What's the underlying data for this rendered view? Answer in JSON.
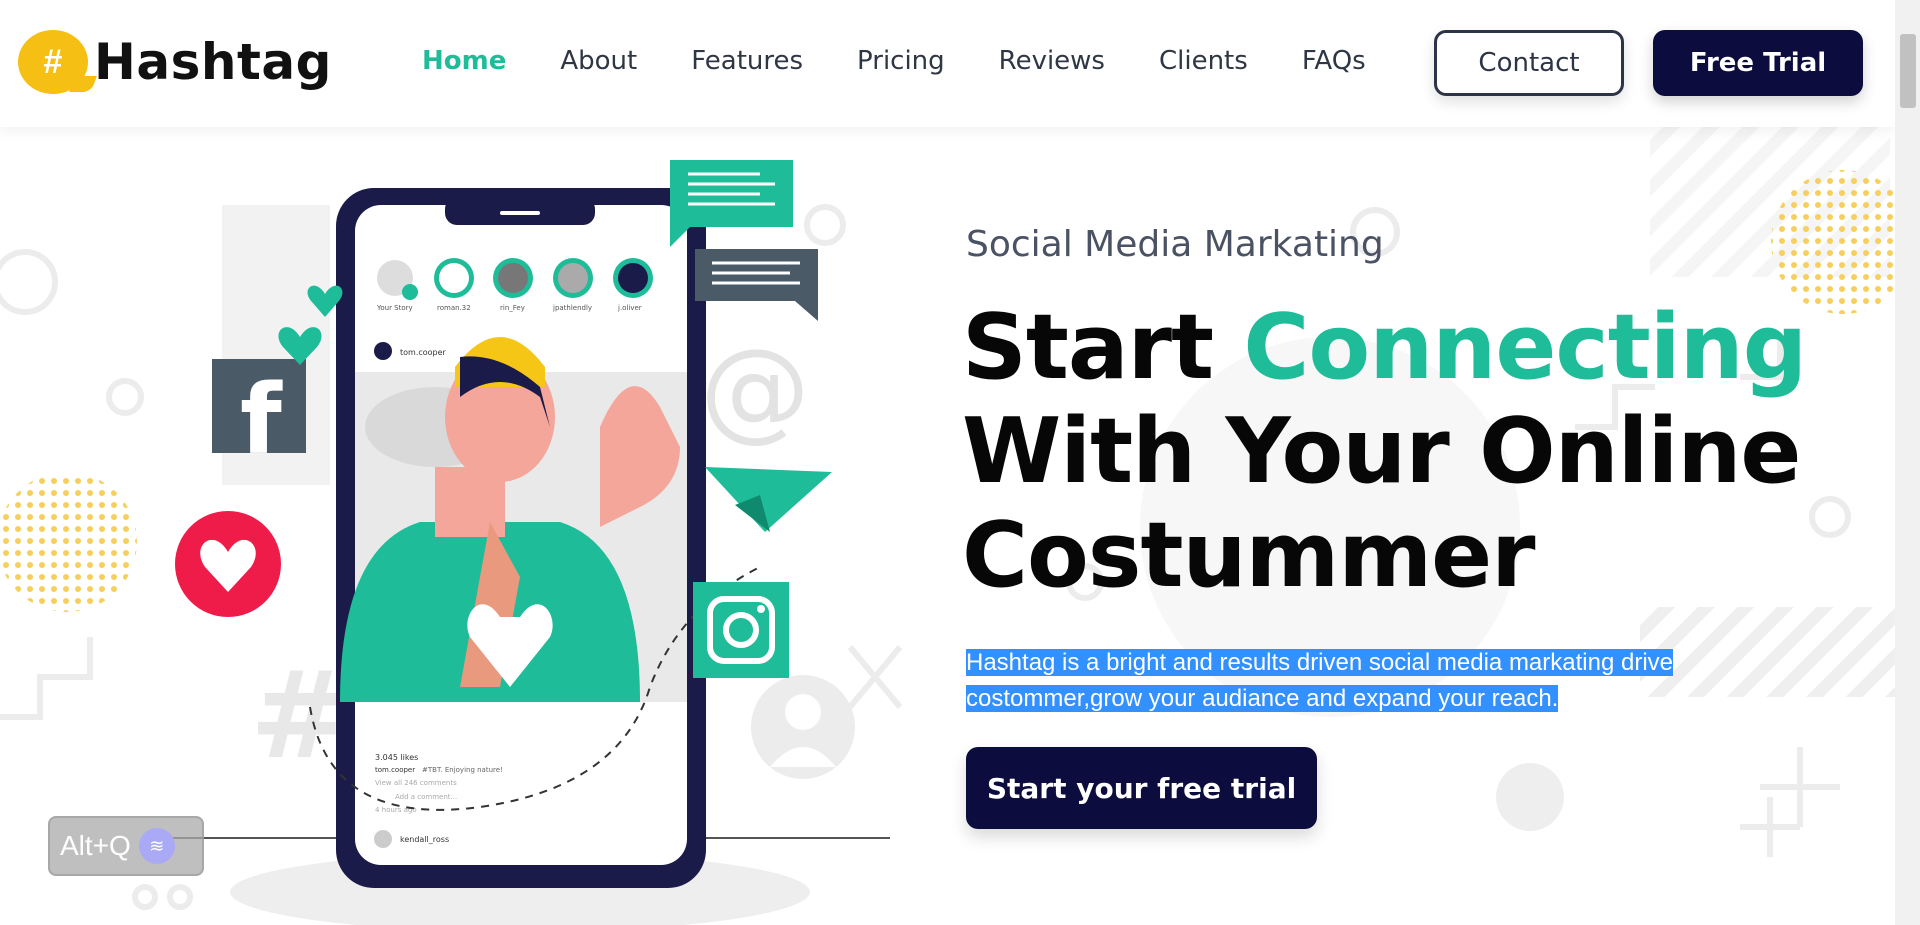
{
  "brand": {
    "name": "Hashtag",
    "logo_glyph": "#",
    "accent": "#1ebc98",
    "dark": "#0c0c3e",
    "yellow": "#f6bf13"
  },
  "nav": {
    "items": [
      {
        "label": "Home",
        "active": true
      },
      {
        "label": "About"
      },
      {
        "label": "Features"
      },
      {
        "label": "Pricing"
      },
      {
        "label": "Reviews"
      },
      {
        "label": "Clients"
      },
      {
        "label": "FAQs"
      }
    ],
    "contact_label": "Contact",
    "trial_label": "Free Trial"
  },
  "hero": {
    "subtitle": "Social Media Markating",
    "headline_pre": "Start",
    "headline_accent": "Connecting",
    "headline_line2": "With Your Online",
    "headline_line3": "Costummer",
    "description": "Hashtag is a bright and results driven social media markating drive costommer,grow your audiance and expand your reach.",
    "cta_label": "Start your free trial"
  },
  "phone": {
    "stories": [
      "Your Story",
      "roman.32",
      "rin_Fey",
      "jpathlendly",
      "j.oliver"
    ],
    "post_user": "tom.cooper",
    "likes": "3.045 likes",
    "caption_user": "tom.cooper",
    "caption_text": "#TBT. Enjoying nature!",
    "view_comments": "View all 246 comments",
    "add_comment": "Add a comment...",
    "time": "4 hours ago",
    "next_user": "kendall_ross"
  },
  "widget": {
    "label": "Alt+Q"
  },
  "icons": [
    "facebook-icon",
    "heart-icon",
    "instagram-icon",
    "paper-plane-icon",
    "chat-bubble-icon",
    "at-sign-icon"
  ]
}
